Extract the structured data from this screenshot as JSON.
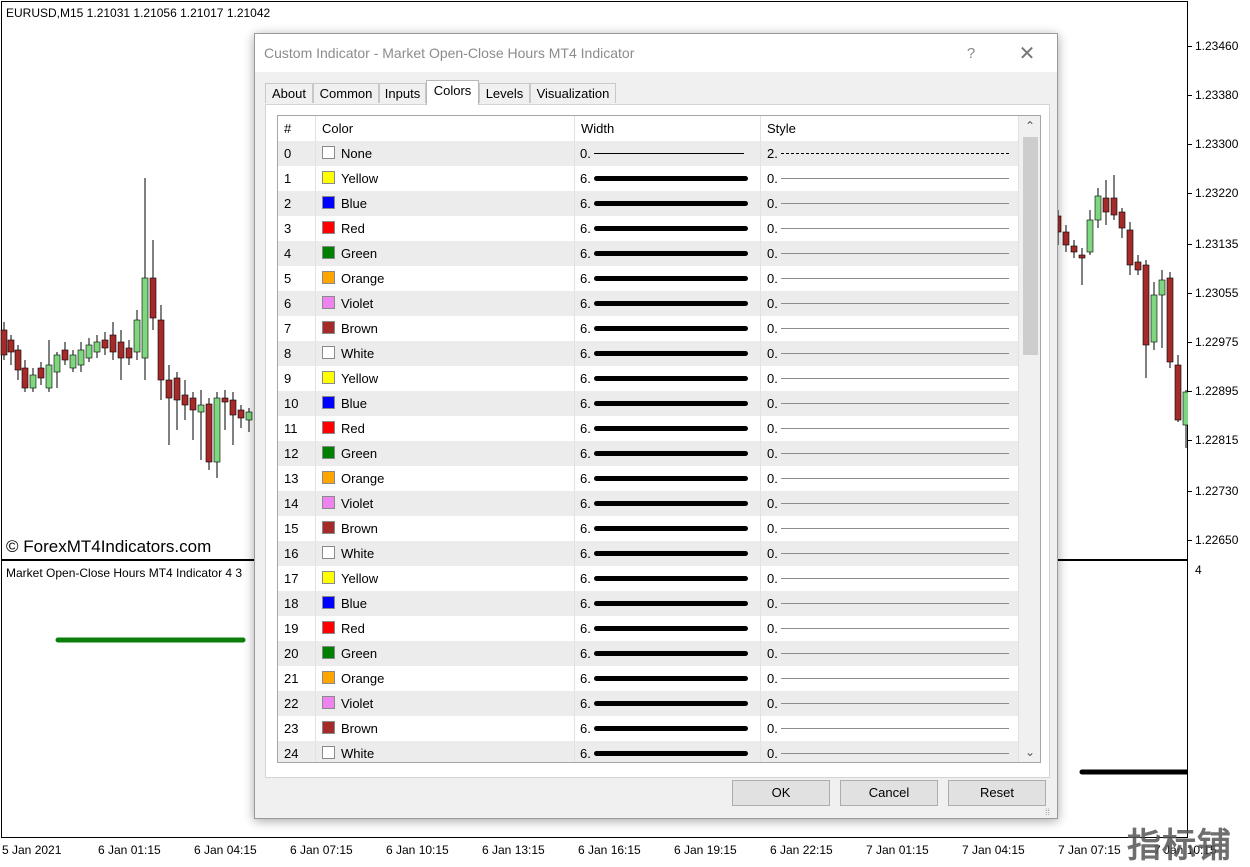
{
  "chart": {
    "symbol_label": "EURUSD,M15  1.21031 1.21056 1.21017 1.21042",
    "watermark": "© ForexMT4Indicators.com",
    "subwindow_label": "Market Open-Close Hours MT4 Indicator 4 3",
    "subwindow_scale": "4",
    "brand_mark": "指标铺",
    "price_labels": [
      "1.23460",
      "1.23380",
      "1.23300",
      "1.23220",
      "1.23135",
      "1.23055",
      "1.22975",
      "1.22895",
      "1.22815",
      "1.22730",
      "1.22650"
    ],
    "time_labels": [
      "5 Jan 2021",
      "6 Jan 01:15",
      "6 Jan 04:15",
      "6 Jan 07:15",
      "6 Jan 10:15",
      "6 Jan 13:15",
      "6 Jan 16:15",
      "6 Jan 19:15",
      "6 Jan 22:15",
      "7 Jan 01:15",
      "7 Jan 04:15",
      "7 Jan 07:15",
      "7 Jan 10:15"
    ],
    "bull_color": "#7ed67e",
    "bear_color": "#a52a2a"
  },
  "dialog": {
    "title": "Custom Indicator - Market Open-Close Hours MT4 Indicator",
    "help_label": "?",
    "close_label": "✕",
    "tabs": [
      "About",
      "Common",
      "Inputs",
      "Colors",
      "Levels",
      "Visualization"
    ],
    "active_tab": "Colors",
    "columns": [
      "#",
      "Color",
      "Width",
      "Style"
    ],
    "rows": [
      {
        "index": "0",
        "color": "None",
        "swatch": "#ffffff",
        "width": "0.",
        "style": "2."
      },
      {
        "index": "1",
        "color": "Yellow",
        "swatch": "#ffff00",
        "width": "6.",
        "style": "0."
      },
      {
        "index": "2",
        "color": "Blue",
        "swatch": "#0000ff",
        "width": "6.",
        "style": "0."
      },
      {
        "index": "3",
        "color": "Red",
        "swatch": "#ff0000",
        "width": "6.",
        "style": "0."
      },
      {
        "index": "4",
        "color": "Green",
        "swatch": "#008000",
        "width": "6.",
        "style": "0."
      },
      {
        "index": "5",
        "color": "Orange",
        "swatch": "#ffa500",
        "width": "6.",
        "style": "0."
      },
      {
        "index": "6",
        "color": "Violet",
        "swatch": "#ee82ee",
        "width": "6.",
        "style": "0."
      },
      {
        "index": "7",
        "color": "Brown",
        "swatch": "#a52a2a",
        "width": "6.",
        "style": "0."
      },
      {
        "index": "8",
        "color": "White",
        "swatch": "#ffffff",
        "width": "6.",
        "style": "0."
      },
      {
        "index": "9",
        "color": "Yellow",
        "swatch": "#ffff00",
        "width": "6.",
        "style": "0."
      },
      {
        "index": "10",
        "color": "Blue",
        "swatch": "#0000ff",
        "width": "6.",
        "style": "0."
      },
      {
        "index": "11",
        "color": "Red",
        "swatch": "#ff0000",
        "width": "6.",
        "style": "0."
      },
      {
        "index": "12",
        "color": "Green",
        "swatch": "#008000",
        "width": "6.",
        "style": "0."
      },
      {
        "index": "13",
        "color": "Orange",
        "swatch": "#ffa500",
        "width": "6.",
        "style": "0."
      },
      {
        "index": "14",
        "color": "Violet",
        "swatch": "#ee82ee",
        "width": "6.",
        "style": "0."
      },
      {
        "index": "15",
        "color": "Brown",
        "swatch": "#a52a2a",
        "width": "6.",
        "style": "0."
      },
      {
        "index": "16",
        "color": "White",
        "swatch": "#ffffff",
        "width": "6.",
        "style": "0."
      },
      {
        "index": "17",
        "color": "Yellow",
        "swatch": "#ffff00",
        "width": "6.",
        "style": "0."
      },
      {
        "index": "18",
        "color": "Blue",
        "swatch": "#0000ff",
        "width": "6.",
        "style": "0."
      },
      {
        "index": "19",
        "color": "Red",
        "swatch": "#ff0000",
        "width": "6.",
        "style": "0."
      },
      {
        "index": "20",
        "color": "Green",
        "swatch": "#008000",
        "width": "6.",
        "style": "0."
      },
      {
        "index": "21",
        "color": "Orange",
        "swatch": "#ffa500",
        "width": "6.",
        "style": "0."
      },
      {
        "index": "22",
        "color": "Violet",
        "swatch": "#ee82ee",
        "width": "6.",
        "style": "0."
      },
      {
        "index": "23",
        "color": "Brown",
        "swatch": "#a52a2a",
        "width": "6.",
        "style": "0."
      },
      {
        "index": "24",
        "color": "White",
        "swatch": "#ffffff",
        "width": "6.",
        "style": "0."
      }
    ],
    "buttons": {
      "ok": "OK",
      "cancel": "Cancel",
      "reset": "Reset"
    },
    "scroll_up_icon": "chevron-up-icon",
    "scroll_down_icon": "chevron-down-icon"
  }
}
